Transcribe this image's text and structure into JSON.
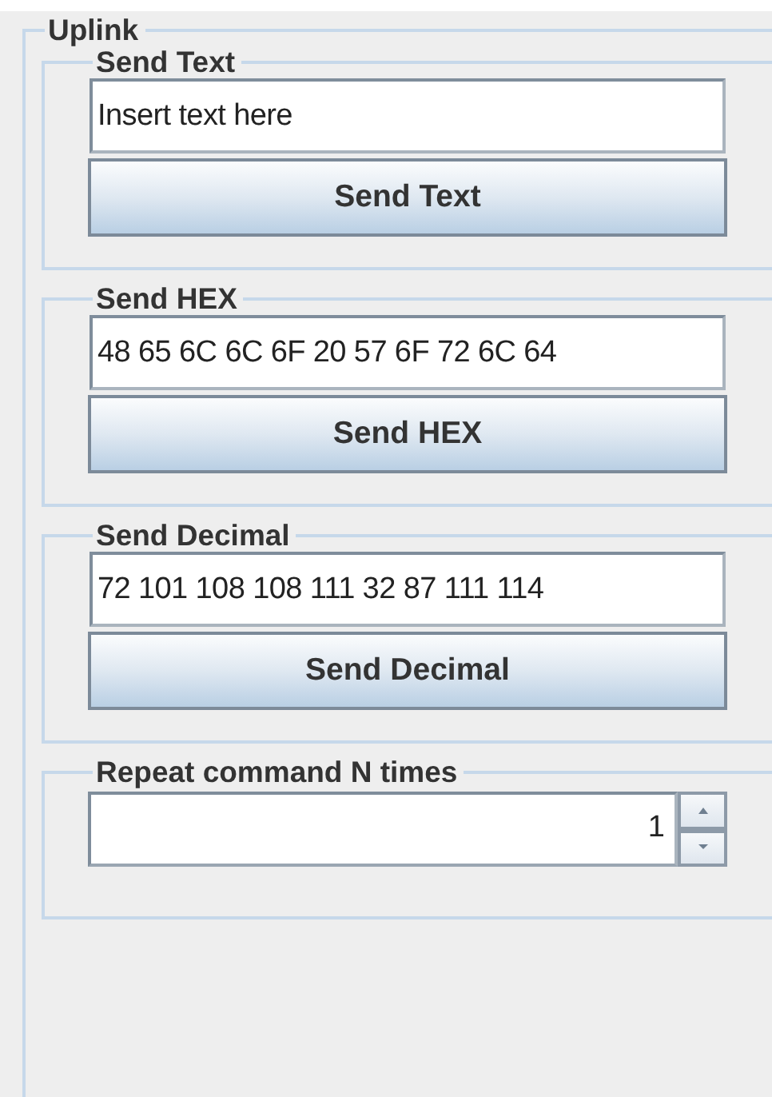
{
  "panel": {
    "title": "Uplink"
  },
  "sections": [
    {
      "kind": "send",
      "title": "Send Text",
      "value": "Insert text here",
      "button": "Send Text"
    },
    {
      "kind": "send",
      "title": "Send HEX",
      "value": "48 65 6C 6C 6F 20 57 6F 72 6C 64",
      "button": "Send HEX"
    },
    {
      "kind": "send",
      "title": "Send Decimal",
      "value": "72 101 108 108 111 32 87 111 114",
      "button": "Send Decimal"
    },
    {
      "kind": "spinner",
      "title": "Repeat command N times",
      "value": "1"
    }
  ]
}
